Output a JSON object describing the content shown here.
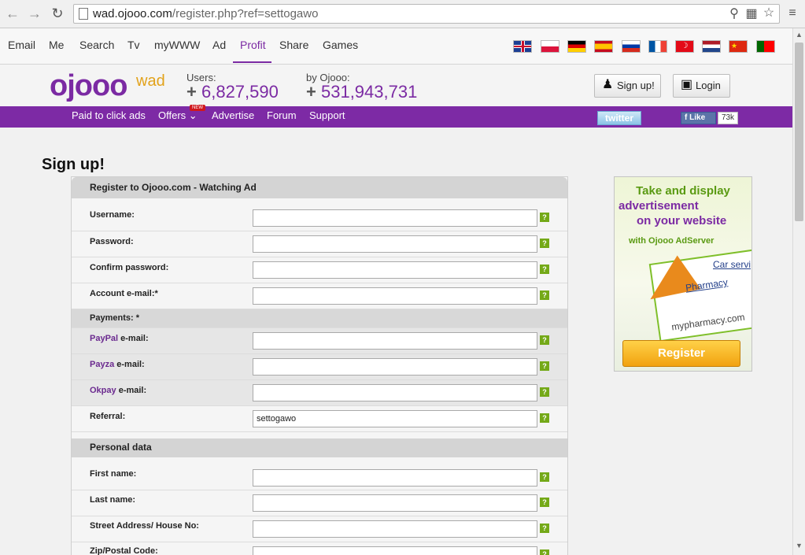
{
  "browser": {
    "url_host": "wad.ojooo.com",
    "url_path": "/register.php?ref=settogawo"
  },
  "topnav": {
    "items": [
      "Email",
      "Me",
      "Search",
      "Tv",
      "myWWW",
      "Ad",
      "Profit",
      "Share",
      "Games"
    ],
    "active": "Profit",
    "flags": [
      "gb-flag-icon",
      "pl-flag-icon",
      "de-flag-icon",
      "es-flag-icon",
      "ru-flag-icon",
      "fr-flag-icon",
      "tr-flag-icon",
      "nl-flag-icon",
      "cn-flag-icon",
      "pt-flag-icon"
    ]
  },
  "header": {
    "logo": "ojooo",
    "logo_sub": "wad",
    "users_label": "Users:",
    "users_value": "6,827,590",
    "byojooo_label": "by Ojooo:",
    "byojooo_value": "531,943,731",
    "signup_label": "Sign up!",
    "login_label": "Login"
  },
  "menu": {
    "items": [
      "Paid to click ads",
      "Offers",
      "Advertise",
      "Forum",
      "Support"
    ],
    "new_badge": "NEW",
    "twitter": "twitter",
    "fb_like": "Like",
    "fb_count": "73k"
  },
  "page": {
    "title": "Sign up!"
  },
  "form": {
    "section1": "Register to Ojooo.com - Watching Ad",
    "username": "Username:",
    "password": "Password:",
    "confirm_password": "Confirm password:",
    "email": "Account e-mail:*",
    "payments": "Payments: *",
    "paypal_name": "PayPal",
    "payza_name": "Payza",
    "okpay_name": "Okpay",
    "email_suffix": " e-mail:",
    "referral": "Referral:",
    "referral_value": "settogawo",
    "section2": "Personal data",
    "first_name": "First name:",
    "last_name": "Last name:",
    "street": "Street Address/ House No:",
    "zip": "Zip/Postal Code:",
    "help": "?"
  },
  "ad": {
    "line1": "Take and display",
    "line2": "advertisement",
    "line3": "on your website",
    "line4": "with Ojooo AdServer",
    "car": "Car servi",
    "pharmacy": "Pharmacy",
    "url": "mypharmacy.com",
    "register": "Register"
  },
  "colors": {
    "brand_purple": "#7b2aa3",
    "help_green": "#74a918"
  }
}
